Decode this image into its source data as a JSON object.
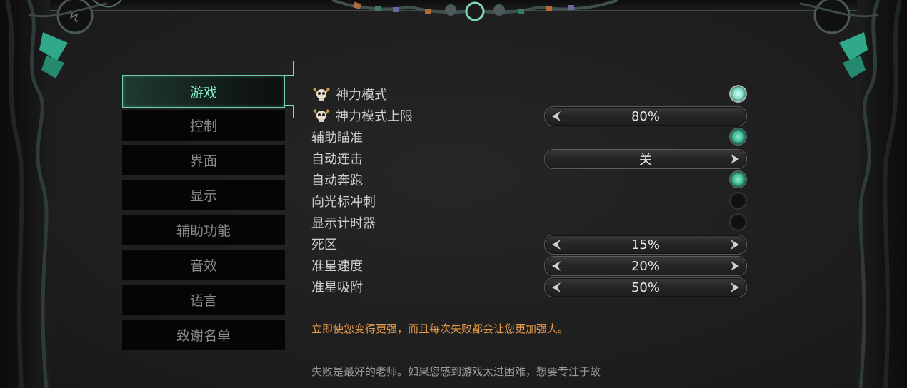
{
  "tabs": [
    {
      "label": "游戏",
      "active": true
    },
    {
      "label": "控制",
      "active": false
    },
    {
      "label": "界面",
      "active": false
    },
    {
      "label": "显示",
      "active": false
    },
    {
      "label": "辅助功能",
      "active": false
    },
    {
      "label": "音效",
      "active": false
    },
    {
      "label": "语言",
      "active": false
    },
    {
      "label": "致谢名单",
      "active": false
    }
  ],
  "settings": [
    {
      "label": "神力模式",
      "icon": "skull-icon",
      "control": "toggle",
      "state": "on"
    },
    {
      "label": "神力模式上限",
      "icon": "skull-icon",
      "control": "selector",
      "value": "80%",
      "arrows": "left-only"
    },
    {
      "label": "辅助瞄准",
      "control": "toggle",
      "state": "on"
    },
    {
      "label": "自动连击",
      "control": "selector",
      "value": "关",
      "arrows": "right-only"
    },
    {
      "label": "自动奔跑",
      "control": "toggle",
      "state": "on"
    },
    {
      "label": "向光标冲刺",
      "control": "toggle",
      "state": "off"
    },
    {
      "label": "显示计时器",
      "control": "toggle",
      "state": "off"
    },
    {
      "label": "死区",
      "control": "selector",
      "value": "15%",
      "arrows": "both"
    },
    {
      "label": "准星速度",
      "control": "selector",
      "value": "20%",
      "arrows": "both"
    },
    {
      "label": "准星吸附",
      "control": "selector",
      "value": "50%",
      "arrows": "both"
    }
  ],
  "description": {
    "highlight": "立即使您变得更强，而且每次失败都会让您更加强大。",
    "body": "失败是最好的老师。如果您感到游戏太过困难，想要专注于故"
  },
  "colors": {
    "accent": "#7fe6c8",
    "highlight_text": "#e79a47",
    "panel_bg": "#1f1f1f"
  }
}
